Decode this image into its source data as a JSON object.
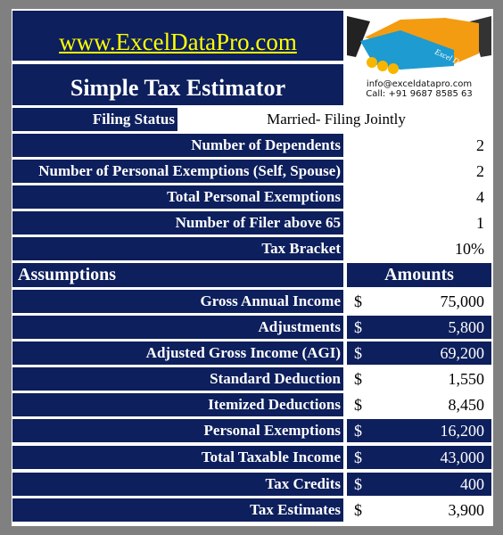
{
  "header": {
    "website": "www.ExcelDataPro.com",
    "title": "Simple Tax Estimator",
    "logo": {
      "text": "Excel Data Pro",
      "email": "info@exceldatapro.com",
      "phone": "Call: +91 9687 8585 63"
    }
  },
  "filing_status": {
    "label": "Filing Status",
    "value": "Married- Filing Jointly"
  },
  "inputs": [
    {
      "label": "Number of Dependents",
      "value": "2"
    },
    {
      "label": "Number of Personal Exemptions (Self, Spouse)",
      "value": "2"
    },
    {
      "label": "Total Personal Exemptions",
      "value": "4"
    },
    {
      "label": "Number of Filer above 65",
      "value": "1"
    },
    {
      "label": "Tax Bracket",
      "value": "10%"
    }
  ],
  "table": {
    "col1": "Assumptions",
    "col2": "Amounts",
    "currency": "$",
    "rows": [
      {
        "label": "Gross Annual Income",
        "value": "75,000",
        "input": true
      },
      {
        "label": "Adjustments",
        "value": "5,800",
        "input": false
      },
      {
        "label": "Adjusted Gross Income (AGI)",
        "value": "69,200",
        "input": false
      },
      {
        "label": "Standard Deduction",
        "value": "1,550",
        "input": true
      },
      {
        "label": "Itemized Deductions",
        "value": "8,450",
        "input": true
      },
      {
        "label": "Personal Exemptions",
        "value": "16,200",
        "input": false
      },
      {
        "label": "Total Taxable Income",
        "value": "43,000",
        "input": false
      },
      {
        "label": "Tax Credits",
        "value": "400",
        "input": false
      },
      {
        "label": "Tax Estimates",
        "value": "3,900",
        "input": true
      }
    ]
  },
  "colors": {
    "navy": "#0d1f5c",
    "link": "#ffff00",
    "background": "#808080"
  }
}
